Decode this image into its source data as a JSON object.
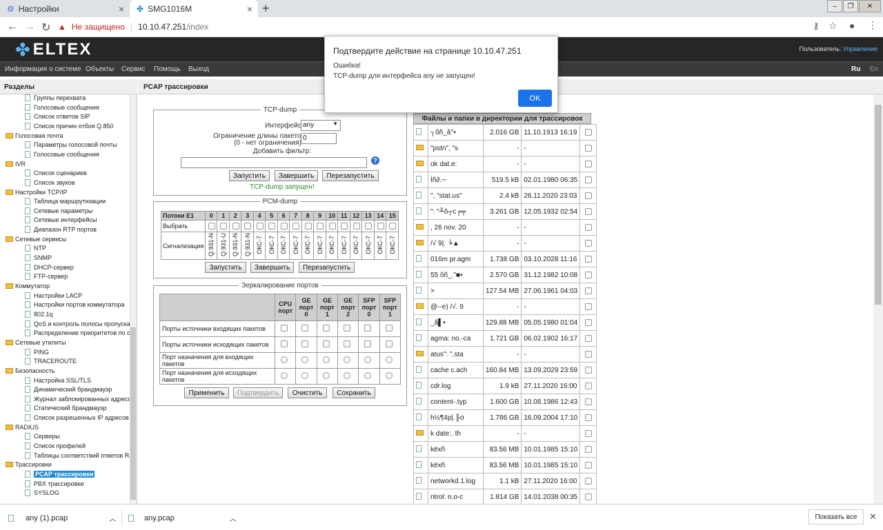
{
  "browser": {
    "tabs": [
      {
        "label": "Настройки"
      },
      {
        "label": "SMG1016M"
      }
    ],
    "url": {
      "security": "Не защищено",
      "host": "10.10.47.251",
      "path": "/index"
    }
  },
  "app": {
    "logo": "ELTEX",
    "user_label": "Пользователь:",
    "user_name": "Управление",
    "menu": [
      "Информация о системе",
      "Объекты",
      "Сервис",
      "Помощь",
      "Выход"
    ],
    "lang": [
      "Ru",
      "En"
    ]
  },
  "sidebar": {
    "title": "Разделы",
    "items": [
      {
        "label": "Группы перехвата",
        "level": 2
      },
      {
        "label": "Голосовые сообщения",
        "level": 2
      },
      {
        "label": "Список ответов SIP",
        "level": 2
      },
      {
        "label": "Список причин отбоя Q.850",
        "level": 2
      },
      {
        "label": "Голосовая почта",
        "level": 1
      },
      {
        "label": "Параметры голосовой почты",
        "level": 2
      },
      {
        "label": "Голосовые сообщения",
        "level": 2
      },
      {
        "label": "IVR",
        "level": 1
      },
      {
        "label": "Список сценариев",
        "level": 2
      },
      {
        "label": "Список звуков",
        "level": 2
      },
      {
        "label": "Настройки TCP/IP",
        "level": 1
      },
      {
        "label": "Таблица маршрутизации",
        "level": 2
      },
      {
        "label": "Сетевые параметры",
        "level": 2
      },
      {
        "label": "Сетевые интерфейсы",
        "level": 2
      },
      {
        "label": "Диапазон RTP портов",
        "level": 2
      },
      {
        "label": "Сетевые сервисы",
        "level": 1
      },
      {
        "label": "NTP",
        "level": 2
      },
      {
        "label": "SNMP",
        "level": 2
      },
      {
        "label": "DHCP-сервер",
        "level": 2
      },
      {
        "label": "FTP-сервер",
        "level": 2
      },
      {
        "label": "Коммутатор",
        "level": 1
      },
      {
        "label": "Настройки LACP",
        "level": 2
      },
      {
        "label": "Настройки портов коммутатора",
        "level": 2
      },
      {
        "label": "802.1q",
        "level": 2
      },
      {
        "label": "QoS и контроль полосы пропускани",
        "level": 2
      },
      {
        "label": "Распределение приоритетов по оче",
        "level": 2
      },
      {
        "label": "Сетевые утилиты",
        "level": 1
      },
      {
        "label": "PING",
        "level": 2
      },
      {
        "label": "TRACEROUTE",
        "level": 2
      },
      {
        "label": "Безопасность",
        "level": 1
      },
      {
        "label": "Настройка SSL/TLS",
        "level": 2
      },
      {
        "label": "Динамический брандмауэр",
        "level": 2
      },
      {
        "label": "Журнал заблокированных адресов",
        "level": 2
      },
      {
        "label": "Статический брандмауэр",
        "level": 2
      },
      {
        "label": "Список разрешенных IP адресов",
        "level": 2
      },
      {
        "label": "RADIUS",
        "level": 1
      },
      {
        "label": "Серверы",
        "level": 2
      },
      {
        "label": "Список профилей",
        "level": 2
      },
      {
        "label": "Таблицы соответствий ответов RAI",
        "level": 2
      },
      {
        "label": "Трассировки",
        "level": 1
      },
      {
        "label": "PCAP трассировки",
        "level": 2,
        "selected": true
      },
      {
        "label": "PBX трассировки",
        "level": 2
      },
      {
        "label": "SYSLOG",
        "level": 2
      }
    ]
  },
  "content": {
    "title": "PCAP трассировки",
    "tcpdump": {
      "legend": "TCP-dump",
      "iface_label": "Интерфейс",
      "iface_value": "any",
      "limit_label1": "Ограничение длины пакетов",
      "limit_label2": "(0 - нет ограничения)",
      "limit_value": "0",
      "filter_label": "Добавить фильтр:",
      "filter_value": "",
      "btn_start": "Запустить",
      "btn_stop": "Завершить",
      "btn_restart": "Перезапустить",
      "status": "TCP-dump запущен!"
    },
    "pcmdump": {
      "legend": "PCM-dump",
      "head_label": "Потоки E1",
      "streams": [
        "0",
        "1",
        "2",
        "3",
        "4",
        "5",
        "6",
        "7",
        "8",
        "9",
        "10",
        "11",
        "12",
        "13",
        "14",
        "15"
      ],
      "select_label": "Выбрать",
      "sig_label": "Сигнализация",
      "signals": [
        "Q.931-N",
        "Q.931-U",
        "Q.931-N",
        "Q.931-N",
        "ОКС-7",
        "ОКС-7",
        "ОКС-7",
        "ОКС-7",
        "ОКС-7",
        "ОКС-7",
        "ОКС-7",
        "ОКС-7",
        "ОКС-7",
        "ОКС-7",
        "ОКС-7",
        "ОКС-7"
      ],
      "btn_start": "Запустить",
      "btn_stop": "Завершить",
      "btn_restart": "Перезапустить"
    },
    "mirror": {
      "legend": "Зеркалирование портов",
      "cols": [
        [
          "CPU",
          "порт"
        ],
        [
          "GE",
          "порт",
          "0"
        ],
        [
          "GE",
          "порт",
          "1"
        ],
        [
          "GE",
          "порт",
          "2"
        ],
        [
          "SFP",
          "порт",
          "0"
        ],
        [
          "SFP",
          "порт",
          "1"
        ]
      ],
      "rows": [
        {
          "label": "Порты источники входящих пакетов",
          "kind": "check"
        },
        {
          "label": "Порты источники исходящих пакетов",
          "kind": "check"
        },
        {
          "label": "Порт назначения для входящих пакетов",
          "kind": "radio"
        },
        {
          "label": "Порт назначения для исходящих пакетов",
          "kind": "radio"
        }
      ],
      "btn_apply": "Применить",
      "btn_confirm": "Подтвердить",
      "btn_clear": "Очистить",
      "btn_save": "Сохранить"
    },
    "files": {
      "header": "Файлы и папки в директории для трассировок",
      "rows": [
        {
          "type": "file",
          "name": "┐õñ_â°•",
          "size": "2.016 GB",
          "date": "11.10.1913 16:19"
        },
        {
          "type": "folder",
          "name": "\"pstn\",  \"s",
          "size": "-",
          "date": "-"
        },
        {
          "type": "folder",
          "name": "ok dat.e:",
          "size": "-",
          "date": "-"
        },
        {
          "type": "file",
          "name": "Ìñ∂.─",
          "size": "519.5 kB",
          "date": "02.01.1980 06:35"
        },
        {
          "type": "file",
          "name": "\", \"stat.us\"",
          "size": "2.4 kB",
          "date": "26.11.2020 23:03"
        },
        {
          "type": "file",
          "name": "\": \"╨ô┬c╒╤",
          "size": "3.261 GB",
          "date": "12.05.1932 02:54"
        },
        {
          "type": "folder",
          "name": ", 26 nov. 20",
          "size": "-",
          "date": "-"
        },
        {
          "type": "folder",
          "name": "/√ 9|. ╘▲",
          "size": "-",
          "date": "-"
        },
        {
          "type": "file",
          "name": "016m pr.agm",
          "size": "1.738 GB",
          "date": "03.10.2028 11:16"
        },
        {
          "type": "file",
          "name": "55 õñ_.\"■•",
          "size": "2.570 GB",
          "date": "31.12.1982 10:08"
        },
        {
          "type": "file",
          "name": ">",
          "size": "127.54 MB",
          "date": "27.06.1961 04:03"
        },
        {
          "type": "folder",
          "name": "@--e) /√. 9",
          "size": "-",
          "date": "-"
        },
        {
          "type": "file",
          "name": "_â▌•",
          "size": "129.88 MB",
          "date": "05.05.1980 01:04"
        },
        {
          "type": "file",
          "name": "agma: no.-ca",
          "size": "1.721 GB",
          "date": "06.02.1902 16:17"
        },
        {
          "type": "folder",
          "name": "atus\": \".sta",
          "size": "-",
          "date": "-"
        },
        {
          "type": "file",
          "name": "cache c.ach",
          "size": "160.84 MB",
          "date": "13.09.2029 23:59"
        },
        {
          "type": "file",
          "name": "cdr.log",
          "size": "1.9 kB",
          "date": "27.11.2020 16:00"
        },
        {
          "type": "file",
          "name": "content-.typ",
          "size": "1.600 GB",
          "date": "10.08.1986 12:43"
        },
        {
          "type": "file",
          "name": "h½¶4p|.╟σ",
          "size": "1.786 GB",
          "date": "16.09.2004 17:10"
        },
        {
          "type": "folder",
          "name": "k date:. th",
          "size": "-",
          "date": "-"
        },
        {
          "type": "file",
          "name": "këxñ",
          "size": "83.56 MB",
          "date": "10.01.1985 15:10"
        },
        {
          "type": "file",
          "name": "këxñ",
          "size": "83.56 MB",
          "date": "10.01.1985 15:10"
        },
        {
          "type": "file",
          "name": "networkd.1.log",
          "size": "1.1 kB",
          "date": "27.11.2020 16:00"
        },
        {
          "type": "file",
          "name": "ntrol: n.o-c",
          "size": "1.814 GB",
          "date": "14.01.2038 00:35"
        }
      ]
    }
  },
  "dialog": {
    "title": "Подтвердите действие на странице 10.10.47.251",
    "line1": "Ошибка!",
    "line2": "TCP-dump для интерфейса any не запущен!",
    "ok": "OK"
  },
  "downloads": {
    "items": [
      "any (1).pcap",
      "any.pcap"
    ],
    "show_all": "Показать все"
  }
}
